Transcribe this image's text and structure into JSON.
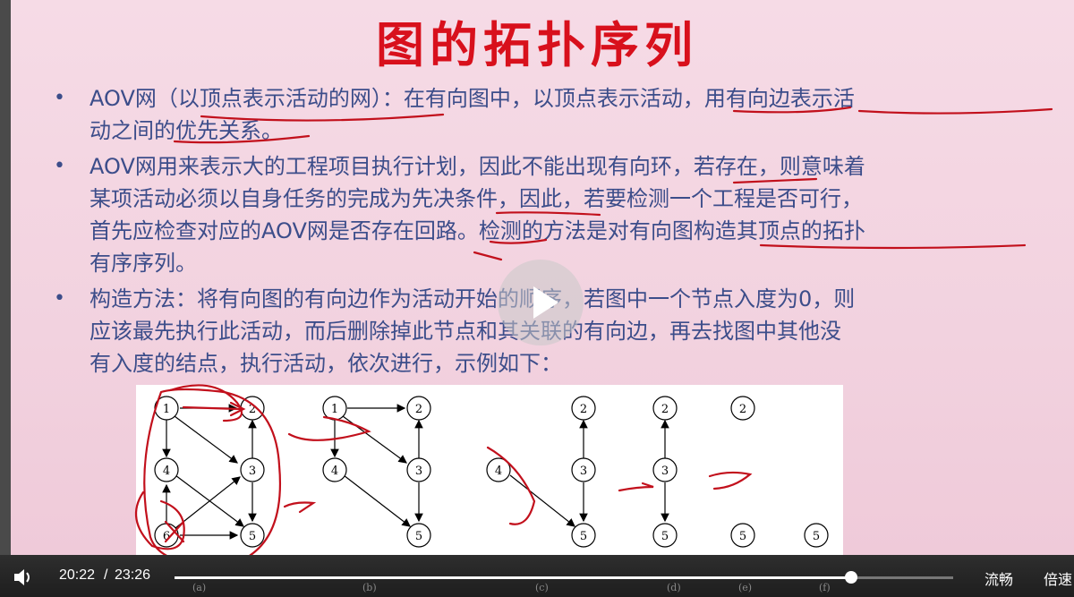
{
  "slide": {
    "title": "图的拓扑序列",
    "bullets": [
      {
        "l1": "AOV网（以顶点表示活动的网）：在有向图中，以顶点表示活动，用有向边表示活",
        "l2": "动之间的优先关系。"
      },
      {
        "l1": "AOV网用来表示大的工程项目执行计划，因此不能出现有向环，若存在，则意味着",
        "l2": "某项活动必须以自身任务的完成为先决条件，因此，若要检测一个工程是否可行，",
        "l3": "首先应检查对应的AOV网是否存在回路。检测的方法是对有向图构造其顶点的拓扑",
        "l4": "有序序列。"
      },
      {
        "l1": "构造方法：将有向图的有向边作为活动开始的顺序，若图中一个节点入度为0，则",
        "l2": "应该最先执行此活动，而后删除掉此节点和其关联的有向边，再去找图中其他没",
        "l3": "有入度的结点，执行活动，依次进行，示例如下："
      }
    ],
    "bullet_marker": "•",
    "figure": {
      "nodes": [
        "1",
        "2",
        "3",
        "4",
        "5",
        "6"
      ],
      "sublabels": [
        "(a)",
        "(b)",
        "(c)",
        "(d)",
        "(e)",
        "(f)"
      ]
    }
  },
  "player": {
    "current_time": "20:22",
    "separator": "/",
    "duration": "23:26",
    "progress": 0.869,
    "quality_label": "流畅",
    "speed_label": "倍速",
    "volume_icon": "speaker-icon",
    "play_icon": "play-icon"
  },
  "colors": {
    "title": "#d8101c",
    "text": "#3c4d8a",
    "ink": "#c2101c",
    "bg": "#f4d6e2"
  }
}
